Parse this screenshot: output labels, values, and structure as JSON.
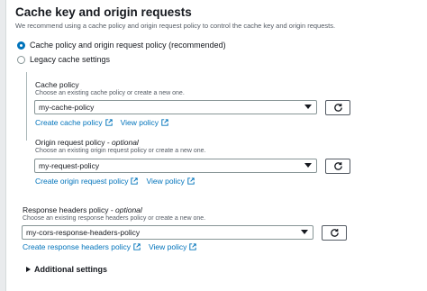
{
  "section": {
    "title": "Cache key and origin requests",
    "description": "We recommend using a cache policy and origin request policy to control the cache key and origin requests."
  },
  "options": [
    {
      "label": "Cache policy and origin request policy (recommended)",
      "selected": true
    },
    {
      "label": "Legacy cache settings",
      "selected": false
    }
  ],
  "cache_policy": {
    "label": "Cache policy",
    "hint": "Choose an existing cache policy or create a new one.",
    "value": "my-cache-policy",
    "create_link": "Create cache policy",
    "view_link": "View policy"
  },
  "origin_request_policy": {
    "label": "Origin request policy",
    "optional": "optional",
    "hint": "Choose an existing origin request policy or create a new one.",
    "value": "my-request-policy",
    "create_link": "Create origin request policy",
    "view_link": "View policy"
  },
  "response_headers_policy": {
    "label": "Response headers policy",
    "optional": "optional",
    "hint": "Choose an existing response headers policy or create a new one.",
    "value": "my-cors-response-headers-policy",
    "create_link": "Create response headers policy",
    "view_link": "View policy"
  },
  "additional_settings": "Additional settings",
  "colors": {
    "link": "#0073bb",
    "radio_selected": "#0073bb"
  },
  "icons": [
    "external-link-icon",
    "refresh-icon",
    "caret-down-icon",
    "expand-triangle-icon"
  ]
}
